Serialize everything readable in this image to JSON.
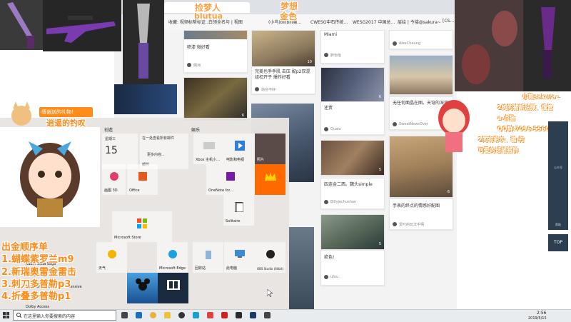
{
  "browser": {
    "bookmarks": [
      "商城 - 全网",
      "收藏: 视频标帮标证…",
      "白领全名与 | 视图",
      "(小鸟)bilibili魔…",
      "CWESG中石传统…",
      "WESG2017 中国总…",
      "层绘 | 今接@sakura~",
      "[CS…"
    ]
  },
  "cards": [
    {
      "title": "喷漆 微好看",
      "user": "阁洲",
      "likes": ""
    },
    {
      "title": "完美也手手肌 击压 配p2双混组杠开子 爆炸好看",
      "user": "站台不好",
      "likes": "10"
    },
    {
      "title": "Miami",
      "user": "胖怡怡",
      "likes": ""
    },
    {
      "title": "",
      "user": "AlexCheung",
      "likes": ""
    },
    {
      "title": "",
      "user": "",
      "likes": "6"
    },
    {
      "title": "",
      "user": "",
      "likes": "6"
    },
    {
      "title": "还贵",
      "user": "Quaio",
      "likes": ""
    },
    {
      "title": "无任何面晶在图。天穹的深蓝",
      "user": "SweetNewsOver",
      "likes": ""
    },
    {
      "title": "",
      "user": "",
      "likes": "6"
    },
    {
      "title": "",
      "user": "",
      "likes": "5"
    },
    {
      "title": "四连金二西。魏头simple",
      "user": "Billyjechushan",
      "likes": ""
    },
    {
      "title": "手表的终点的情感好配图",
      "user": "爱叶的玩法手柄",
      "likes": ""
    },
    {
      "title": "",
      "user": "",
      "likes": "5"
    },
    {
      "title": "绝色!",
      "user": "ufou",
      "likes": ""
    }
  ],
  "start_menu": {
    "section1": "创造",
    "section2": "娱乐",
    "tiles": [
      {
        "label": "",
        "top_text": "星期三",
        "big_text": "15"
      },
      {
        "label": "邮件",
        "top_text": "在一处查看所有邮件",
        "big_text": "更多内容..."
      },
      {
        "label": "Xbox 主机小…"
      },
      {
        "label": "电影和电视"
      },
      {
        "label": "照片"
      },
      {
        "label": "画图 3D"
      },
      {
        "label": "Office"
      },
      {
        "label": "OneNote for…"
      },
      {
        "label": "Microsoft Store"
      },
      {
        "label": "Solitaire"
      },
      {
        "label": "天气"
      },
      {
        "label": "Microsoft Edge"
      },
      {
        "label": "回收站"
      },
      {
        "label": "此电脑"
      },
      {
        "label": "OBS Studio (64bit)"
      },
      {
        "label": ""
      },
      {
        "label": ""
      }
    ],
    "list_items": [
      "Kaam Soda Saga",
      "Cortana",
      "Counter-Strike Global Offensive",
      "Dolby Access"
    ]
  },
  "overlay": {
    "top_texts": [
      "捡梦人",
      "biutua",
      "梦想",
      "金色"
    ],
    "thanks": "感谢送的礼物！",
    "thanks2": "逍遥的钓叹",
    "order_title": "出金顺序单",
    "orders": [
      "1.蝴蝶紫罗兰m9",
      "2.新瑞奥雷金雷击",
      "3.刺刀多普勒p3",
      "4.折叠多普勒p1"
    ],
    "social": [
      "小熊sakura~",
      "2纯的猪新姑频、俄管",
      "a-点猫",
      "QQ群:7096-55604",
      "2的有彩次、猫-打",
      "可爱的话猫猪群"
    ]
  },
  "search": {
    "placeholder": "在这里输入你要搜索的内容"
  },
  "sidebar": {
    "items": [
      "",
      "",
      "",
      "公众号",
      "",
      "",
      "",
      "",
      "帮助"
    ],
    "top": "TOP"
  },
  "taskbar": {
    "time": "2:56",
    "date": "2019/5/15"
  },
  "colors": {
    "accent": "#ff8c1a",
    "startmenu": "#e8e4e2",
    "obs_orange": "#ff6a00"
  }
}
